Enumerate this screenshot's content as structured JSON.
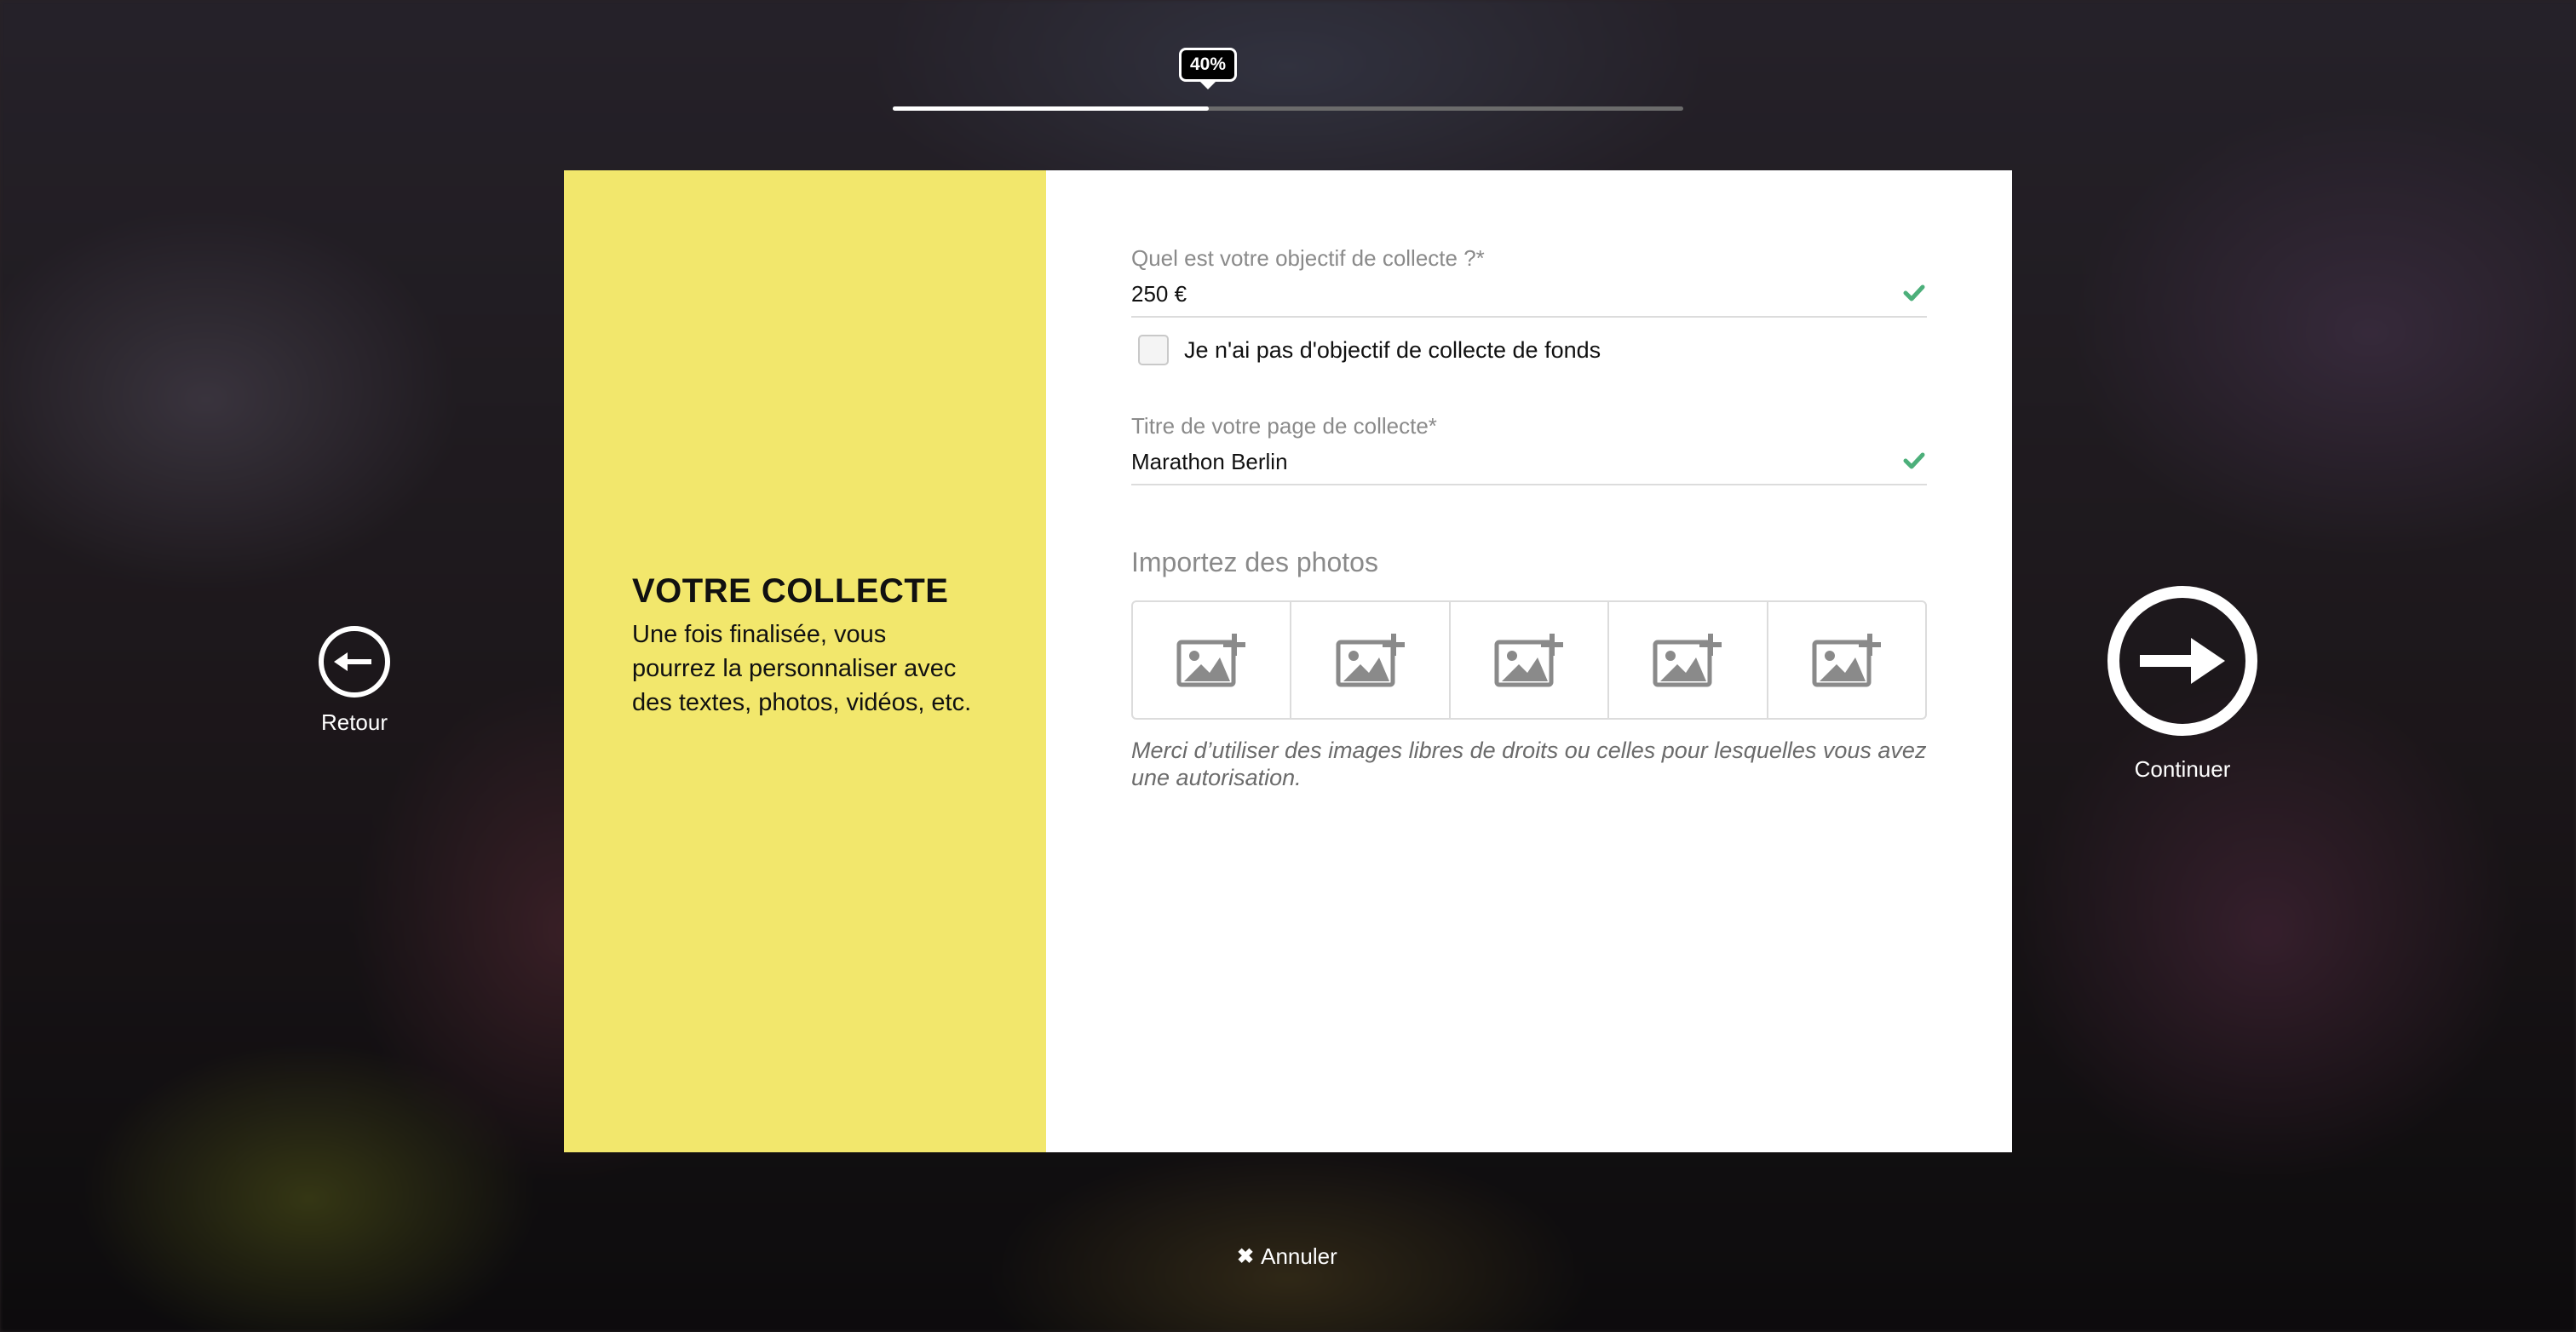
{
  "progress": {
    "percent_label": "40%",
    "value": 0.4
  },
  "left_panel": {
    "title": "VOTRE COLLECTE",
    "description": "Une fois finalisée, vous pourrez la personnaliser avec des textes, photos, vidéos, etc."
  },
  "form": {
    "goal": {
      "label": "Quel est votre objectif de collecte ?*",
      "value": "250 €",
      "valid": true
    },
    "no_goal_checkbox": {
      "label": "Je n'ai pas d'objectif de collecte de fonds",
      "checked": false
    },
    "title": {
      "label": "Titre de votre page de collecte*",
      "value": "Marathon Berlin",
      "valid": true
    },
    "photos": {
      "title": "Importez des photos",
      "slots": [
        "add-image-icon",
        "add-image-icon",
        "add-image-icon",
        "add-image-icon",
        "add-image-icon"
      ],
      "note": "Merci d’utiliser des images libres de droits ou celles pour lesquelles vous avez une autorisation."
    }
  },
  "nav": {
    "back_label": "Retour",
    "next_label": "Continuer",
    "cancel_label": "Annuler"
  },
  "colors": {
    "accent_yellow": "#f2e76c",
    "check_green": "#4caf7a"
  }
}
